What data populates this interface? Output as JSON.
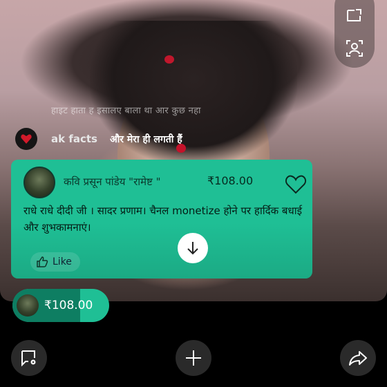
{
  "overlay": {
    "caption": "हाइट हाता ह इसालए बाला था आर कुछ नहा"
  },
  "chat": {
    "author": "ak facts",
    "message": "और मेरा ही लगती हैं"
  },
  "superchat": {
    "author": "कवि प्रसून पांडेय \"रामेष्ट \"",
    "amount": "₹108.00",
    "message": "राधे राधे दीदी जी । सादर प्रणाम। चैनल monetize होने पर हार्दिक बधाई और शुभकामनाएं।",
    "like_label": "Like",
    "color": "#1fbf95"
  },
  "ticker": {
    "amount": "₹108.00",
    "progress": 0.7
  },
  "icons": {
    "side_top": "open-in-window-icon",
    "side_bottom": "people-frame-icon",
    "like": "thumbs-up-icon",
    "heart": "heart-outline-icon",
    "scroll": "arrow-down-icon",
    "bottom_left": "chat-settings-icon",
    "bottom_center": "plus-icon",
    "bottom_right": "share-icon"
  }
}
